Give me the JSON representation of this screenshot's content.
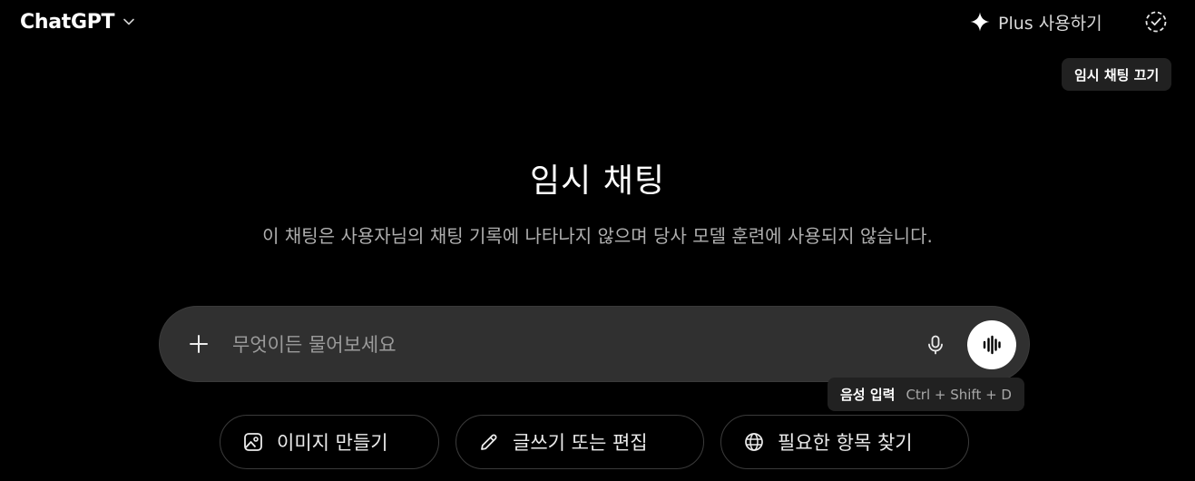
{
  "header": {
    "model_name": "ChatGPT",
    "upgrade_label": "Plus 사용하기",
    "temp_chat_tooltip": "임시 채팅 끄기"
  },
  "main": {
    "title": "임시 채팅",
    "subtitle": "이 채팅은 사용자님의 채팅 기록에 나타나지 않으며 당사 모델 훈련에 사용되지 않습니다."
  },
  "composer": {
    "placeholder": "무엇이든 물어보세요",
    "value": "",
    "voice_tooltip": {
      "label": "음성 입력",
      "shortcut": "Ctrl + Shift + D"
    }
  },
  "suggestions": [
    {
      "label": "이미지 만들기",
      "icon": "image-icon"
    },
    {
      "label": "글쓰기 또는 편집",
      "icon": "pencil-icon"
    },
    {
      "label": "필요한 항목 찾기",
      "icon": "globe-icon"
    }
  ],
  "colors": {
    "background": "#000000",
    "composer": "#303030",
    "tooltip": "#212121",
    "text": "#ececec",
    "muted": "#afafaf"
  }
}
